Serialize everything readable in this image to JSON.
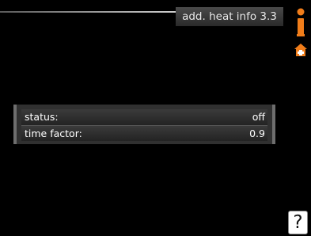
{
  "header": {
    "title": "add. heat info 3.3"
  },
  "side_icons": [
    {
      "name": "info-icon",
      "color": "#f07d1a"
    },
    {
      "name": "house-icon",
      "color": "#f07d1a"
    }
  ],
  "info_panel": {
    "rows": [
      {
        "label": "status:",
        "value": "off"
      },
      {
        "label": "time factor:",
        "value": "0.9"
      }
    ]
  },
  "help_button": {
    "label": "?"
  },
  "colors": {
    "background": "#000000",
    "accent": "#f07d1a",
    "panel": "#303030"
  }
}
